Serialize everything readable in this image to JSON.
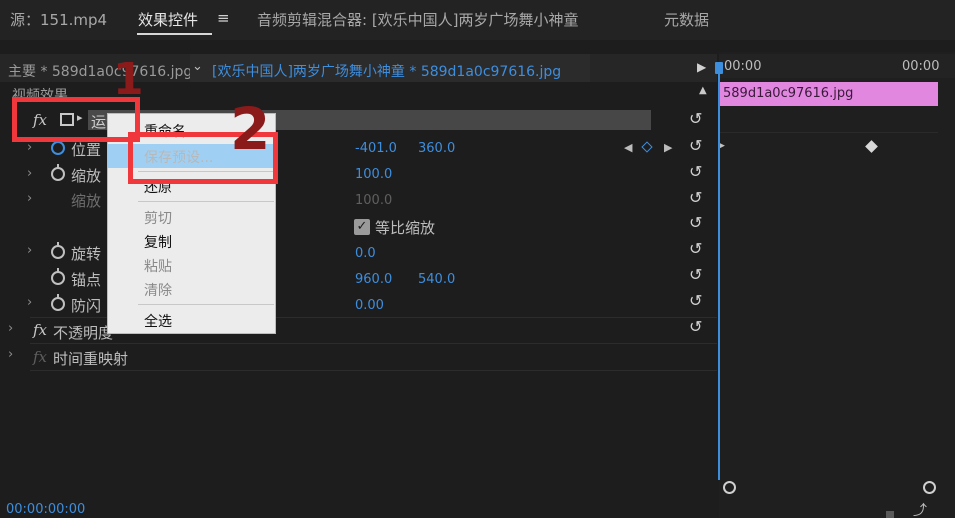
{
  "tabs": {
    "source": "源：151.mp4",
    "effect_controls": "效果控件",
    "audio_mixer": "音频剪辑混合器: [欢乐中国人]两岁广场舞小神童",
    "metadata": "元数据",
    "menu_icon": "≡"
  },
  "breadcrumb": {
    "master": "主要 * 589d1a0c97616.jpg",
    "sequence": "[欢乐中国人]两岁广场舞小神童 * 589d1a0c97616.jpg"
  },
  "section": {
    "video_effects": "视频效果"
  },
  "effects": {
    "motion": {
      "fx": "fx",
      "label": "运动"
    },
    "position": {
      "label": "位置",
      "x": "-401.0",
      "y": "360.0"
    },
    "scale": {
      "label": "缩放",
      "value": "100.0"
    },
    "scale_width": {
      "label": "缩放",
      "value": "100.0"
    },
    "uniform_scale": {
      "label": "等比缩放",
      "checked": true
    },
    "rotation": {
      "label": "旋转",
      "value": "0.0"
    },
    "anchor": {
      "label": "锚点",
      "x": "960.0",
      "y": "540.0"
    },
    "anti_flicker": {
      "label": "防闪",
      "value": "0.00"
    },
    "opacity": {
      "fx": "fx",
      "label": "不透明度"
    },
    "time_remap": {
      "fx": "fx",
      "label": "时间重映射"
    }
  },
  "context_menu": {
    "items": [
      {
        "label": "重命名",
        "state": "enabled"
      },
      {
        "label": "保存预设...",
        "state": "hover"
      },
      {
        "label": "还原",
        "state": "enabled"
      },
      {
        "label": "剪切",
        "state": "disabled"
      },
      {
        "label": "复制",
        "state": "enabled"
      },
      {
        "label": "粘贴",
        "state": "disabled"
      },
      {
        "label": "清除",
        "state": "disabled"
      },
      {
        "label": "全选",
        "state": "enabled"
      }
    ]
  },
  "timeline": {
    "ruler_start": "00:00",
    "ruler_end": "00:00",
    "clip_name": "589d1a0c97616.jpg"
  },
  "footer": {
    "timecode": "00:00:00:00"
  },
  "annotations": {
    "step1": "1",
    "step2": "2"
  },
  "colors": {
    "accent": "#3e8ede",
    "clip": "#e187e0",
    "annotation": "#f0383c",
    "menu_hover": "#9fd0f4"
  }
}
